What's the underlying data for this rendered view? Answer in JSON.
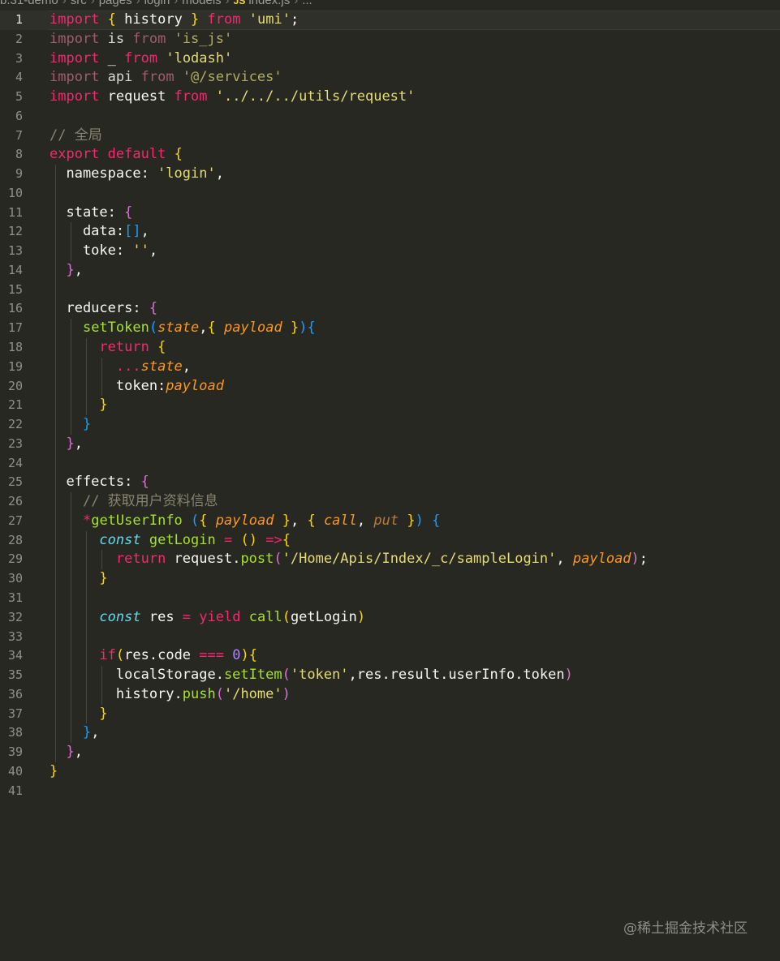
{
  "breadcrumb": {
    "items": [
      "b.31-demo",
      "src",
      "pages",
      "login",
      "models"
    ],
    "file_badge": "JS",
    "file_name": "index.js",
    "trailing": "..."
  },
  "editor": {
    "active_line": 1,
    "lines": [
      {
        "n": "1",
        "g": 0,
        "t": [
          [
            "kw",
            "import"
          ],
          [
            "",
            " "
          ],
          [
            "b1",
            "{"
          ],
          [
            "",
            " history "
          ],
          [
            "b1",
            "}"
          ],
          [
            "",
            " "
          ],
          [
            "kw",
            "from"
          ],
          [
            "",
            " "
          ],
          [
            "str",
            "'umi'"
          ],
          [
            "",
            ";"
          ]
        ]
      },
      {
        "n": "2",
        "g": 0,
        "t": [
          [
            "kwd",
            "import"
          ],
          [
            "dim",
            " is "
          ],
          [
            "kwd",
            "from"
          ],
          [
            "",
            " "
          ],
          [
            "strd",
            "'is_js'"
          ]
        ]
      },
      {
        "n": "3",
        "g": 0,
        "t": [
          [
            "kw",
            "import"
          ],
          [
            "",
            " _ "
          ],
          [
            "kw",
            "from"
          ],
          [
            "",
            " "
          ],
          [
            "str",
            "'lodash'"
          ]
        ]
      },
      {
        "n": "4",
        "g": 0,
        "t": [
          [
            "kwd",
            "import"
          ],
          [
            "dim",
            " api "
          ],
          [
            "kwd",
            "from"
          ],
          [
            "",
            " "
          ],
          [
            "strd",
            "'@/services'"
          ]
        ]
      },
      {
        "n": "5",
        "g": 0,
        "t": [
          [
            "kw",
            "import"
          ],
          [
            "",
            " request "
          ],
          [
            "kw",
            "from"
          ],
          [
            "",
            " "
          ],
          [
            "str",
            "'../../../utils/request'"
          ]
        ]
      },
      {
        "n": "6",
        "g": 0,
        "t": []
      },
      {
        "n": "7",
        "g": 0,
        "t": [
          [
            "cm",
            "// 全局"
          ]
        ]
      },
      {
        "n": "8",
        "g": 0,
        "t": [
          [
            "kw",
            "export"
          ],
          [
            "",
            " "
          ],
          [
            "kw",
            "default"
          ],
          [
            "",
            " "
          ],
          [
            "b1",
            "{"
          ]
        ]
      },
      {
        "n": "9",
        "g": 1,
        "t": [
          [
            "",
            "  namespace: "
          ],
          [
            "str",
            "'login'"
          ],
          [
            "",
            ","
          ]
        ]
      },
      {
        "n": "10",
        "g": 1,
        "t": []
      },
      {
        "n": "11",
        "g": 1,
        "t": [
          [
            "",
            "  state: "
          ],
          [
            "b2",
            "{"
          ]
        ]
      },
      {
        "n": "12",
        "g": 2,
        "t": [
          [
            "",
            "    data:"
          ],
          [
            "b3",
            "[]"
          ],
          [
            "",
            ","
          ]
        ]
      },
      {
        "n": "13",
        "g": 2,
        "t": [
          [
            "",
            "    toke: "
          ],
          [
            "str",
            "''"
          ],
          [
            "",
            ","
          ]
        ]
      },
      {
        "n": "14",
        "g": 1,
        "t": [
          [
            "",
            "  "
          ],
          [
            "b2",
            "}"
          ],
          [
            "",
            ","
          ]
        ]
      },
      {
        "n": "15",
        "g": 1,
        "t": []
      },
      {
        "n": "16",
        "g": 1,
        "t": [
          [
            "",
            "  reducers: "
          ],
          [
            "b2",
            "{"
          ]
        ]
      },
      {
        "n": "17",
        "g": 2,
        "t": [
          [
            "",
            "    "
          ],
          [
            "fn",
            "setToken"
          ],
          [
            "b3",
            "("
          ],
          [
            "par",
            "state"
          ],
          [
            "",
            ","
          ],
          [
            "b1",
            "{"
          ],
          [
            "",
            " "
          ],
          [
            "par",
            "payload"
          ],
          [
            "",
            " "
          ],
          [
            "b1",
            "}"
          ],
          [
            "b3",
            ")"
          ],
          [
            "b3",
            "{"
          ]
        ]
      },
      {
        "n": "18",
        "g": 3,
        "t": [
          [
            "",
            "      "
          ],
          [
            "kw",
            "return"
          ],
          [
            "",
            " "
          ],
          [
            "b1",
            "{"
          ]
        ]
      },
      {
        "n": "19",
        "g": 4,
        "t": [
          [
            "",
            "        "
          ],
          [
            "kw",
            "..."
          ],
          [
            "par",
            "state"
          ],
          [
            "",
            ","
          ]
        ]
      },
      {
        "n": "20",
        "g": 4,
        "t": [
          [
            "",
            "        token:"
          ],
          [
            "par",
            "payload"
          ]
        ]
      },
      {
        "n": "21",
        "g": 3,
        "t": [
          [
            "",
            "      "
          ],
          [
            "b1",
            "}"
          ]
        ]
      },
      {
        "n": "22",
        "g": 2,
        "t": [
          [
            "",
            "    "
          ],
          [
            "b3",
            "}"
          ]
        ]
      },
      {
        "n": "23",
        "g": 1,
        "t": [
          [
            "",
            "  "
          ],
          [
            "b2",
            "}"
          ],
          [
            "",
            ","
          ]
        ]
      },
      {
        "n": "24",
        "g": 1,
        "t": []
      },
      {
        "n": "25",
        "g": 1,
        "t": [
          [
            "",
            "  effects: "
          ],
          [
            "b2",
            "{"
          ]
        ]
      },
      {
        "n": "26",
        "g": 2,
        "t": [
          [
            "",
            "    "
          ],
          [
            "cm",
            "// 获取用户资料信息"
          ]
        ]
      },
      {
        "n": "27",
        "g": 2,
        "t": [
          [
            "",
            "    "
          ],
          [
            "kw",
            "*"
          ],
          [
            "fn",
            "getUserInfo"
          ],
          [
            "",
            " "
          ],
          [
            "b3",
            "("
          ],
          [
            "b1",
            "{"
          ],
          [
            "",
            " "
          ],
          [
            "par",
            "payload"
          ],
          [
            "",
            " "
          ],
          [
            "b1",
            "}"
          ],
          [
            "",
            ", "
          ],
          [
            "b1",
            "{"
          ],
          [
            "",
            " "
          ],
          [
            "par",
            "call"
          ],
          [
            "",
            ", "
          ],
          [
            "parm",
            "put"
          ],
          [
            "",
            " "
          ],
          [
            "b1",
            "}"
          ],
          [
            "b3",
            ")"
          ],
          [
            "",
            " "
          ],
          [
            "b3",
            "{"
          ]
        ]
      },
      {
        "n": "28",
        "g": 3,
        "t": [
          [
            "",
            "      "
          ],
          [
            "con",
            "const"
          ],
          [
            "",
            " "
          ],
          [
            "fn",
            "getLogin"
          ],
          [
            "",
            " "
          ],
          [
            "kw",
            "="
          ],
          [
            "",
            " "
          ],
          [
            "b1",
            "()"
          ],
          [
            "",
            " "
          ],
          [
            "kw",
            "=>"
          ],
          [
            "b1",
            "{"
          ]
        ]
      },
      {
        "n": "29",
        "g": 4,
        "t": [
          [
            "",
            "        "
          ],
          [
            "kw",
            "return"
          ],
          [
            "",
            " request."
          ],
          [
            "fn",
            "post"
          ],
          [
            "b2",
            "("
          ],
          [
            "str",
            "'/Home/Apis/Index/_c/sampleLogin'"
          ],
          [
            "",
            ", "
          ],
          [
            "par",
            "payload"
          ],
          [
            "b2",
            ")"
          ],
          [
            "",
            ";"
          ]
        ]
      },
      {
        "n": "30",
        "g": 3,
        "t": [
          [
            "",
            "      "
          ],
          [
            "b1",
            "}"
          ]
        ]
      },
      {
        "n": "31",
        "g": 3,
        "t": []
      },
      {
        "n": "32",
        "g": 3,
        "t": [
          [
            "",
            "      "
          ],
          [
            "con",
            "const"
          ],
          [
            "",
            " res "
          ],
          [
            "kw",
            "="
          ],
          [
            "",
            " "
          ],
          [
            "kw",
            "yield"
          ],
          [
            "",
            " "
          ],
          [
            "fn",
            "call"
          ],
          [
            "b1",
            "("
          ],
          [
            "",
            "getLogin"
          ],
          [
            "b1",
            ")"
          ]
        ]
      },
      {
        "n": "33",
        "g": 3,
        "t": []
      },
      {
        "n": "34",
        "g": 3,
        "t": [
          [
            "",
            "      "
          ],
          [
            "kw",
            "if"
          ],
          [
            "b1",
            "("
          ],
          [
            "",
            "res.code "
          ],
          [
            "kw",
            "==="
          ],
          [
            "",
            " "
          ],
          [
            "num",
            "0"
          ],
          [
            "b1",
            ")"
          ],
          [
            "b1",
            "{"
          ]
        ]
      },
      {
        "n": "35",
        "g": 4,
        "t": [
          [
            "",
            "        localStorage."
          ],
          [
            "fn",
            "setItem"
          ],
          [
            "b2",
            "("
          ],
          [
            "str",
            "'token'"
          ],
          [
            "",
            ",res.result.userInfo.token"
          ],
          [
            "b2",
            ")"
          ]
        ]
      },
      {
        "n": "36",
        "g": 4,
        "t": [
          [
            "",
            "        history."
          ],
          [
            "fn",
            "push"
          ],
          [
            "b2",
            "("
          ],
          [
            "str",
            "'/home'"
          ],
          [
            "b2",
            ")"
          ]
        ]
      },
      {
        "n": "37",
        "g": 3,
        "t": [
          [
            "",
            "      "
          ],
          [
            "b1",
            "}"
          ]
        ]
      },
      {
        "n": "38",
        "g": 2,
        "t": [
          [
            "",
            "    "
          ],
          [
            "b3",
            "}"
          ],
          [
            "",
            ","
          ]
        ]
      },
      {
        "n": "39",
        "g": 1,
        "t": [
          [
            "",
            "  "
          ],
          [
            "b2",
            "}"
          ],
          [
            "",
            ","
          ]
        ]
      },
      {
        "n": "40",
        "g": 0,
        "t": [
          [
            "b1",
            "}"
          ]
        ]
      },
      {
        "n": "41",
        "g": 0,
        "t": []
      }
    ]
  },
  "watermark": "@稀土掘金技术社区"
}
